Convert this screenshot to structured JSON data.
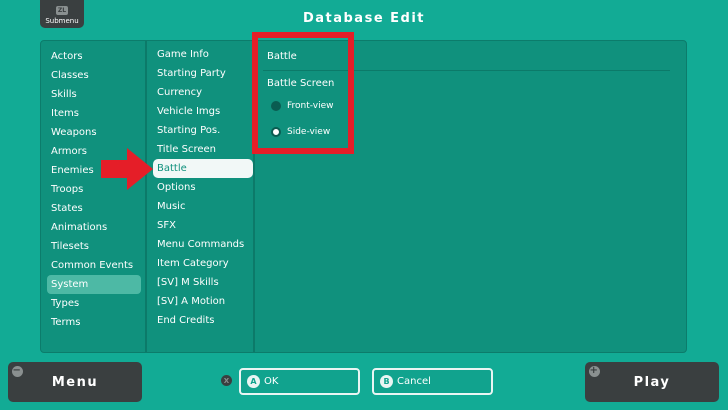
{
  "header": {
    "submenu_key": "ZL",
    "submenu_label": "Submenu",
    "title": "Database Edit"
  },
  "categories": [
    "Actors",
    "Classes",
    "Skills",
    "Items",
    "Weapons",
    "Armors",
    "Enemies",
    "Troops",
    "States",
    "Animations",
    "Tilesets",
    "Common Events",
    "System",
    "Types",
    "Terms"
  ],
  "selected_category": "System",
  "system_items": [
    "Game Info",
    "Starting Party",
    "Currency",
    "Vehicle Imgs",
    "Starting Pos.",
    "Title Screen",
    "Battle",
    "Options",
    "Music",
    "SFX",
    "Menu Commands",
    "Item Category",
    "[SV] M Skills",
    "[SV] A Motion",
    "End Credits"
  ],
  "selected_system_item": "Battle",
  "detail": {
    "heading": "Battle",
    "section": "Battle Screen",
    "options": [
      {
        "label": "Front-view",
        "selected": false
      },
      {
        "label": "Side-view",
        "selected": true
      }
    ]
  },
  "footer": {
    "menu_label": "Menu",
    "menu_key": "−",
    "play_label": "Play",
    "play_key": "+",
    "x_key": "X",
    "ok_key": "A",
    "ok_label": "OK",
    "cancel_key": "B",
    "cancel_label": "Cancel"
  },
  "colors": {
    "background": "#12ab95",
    "panel": "#10917d",
    "annotation": "#e51e28"
  }
}
